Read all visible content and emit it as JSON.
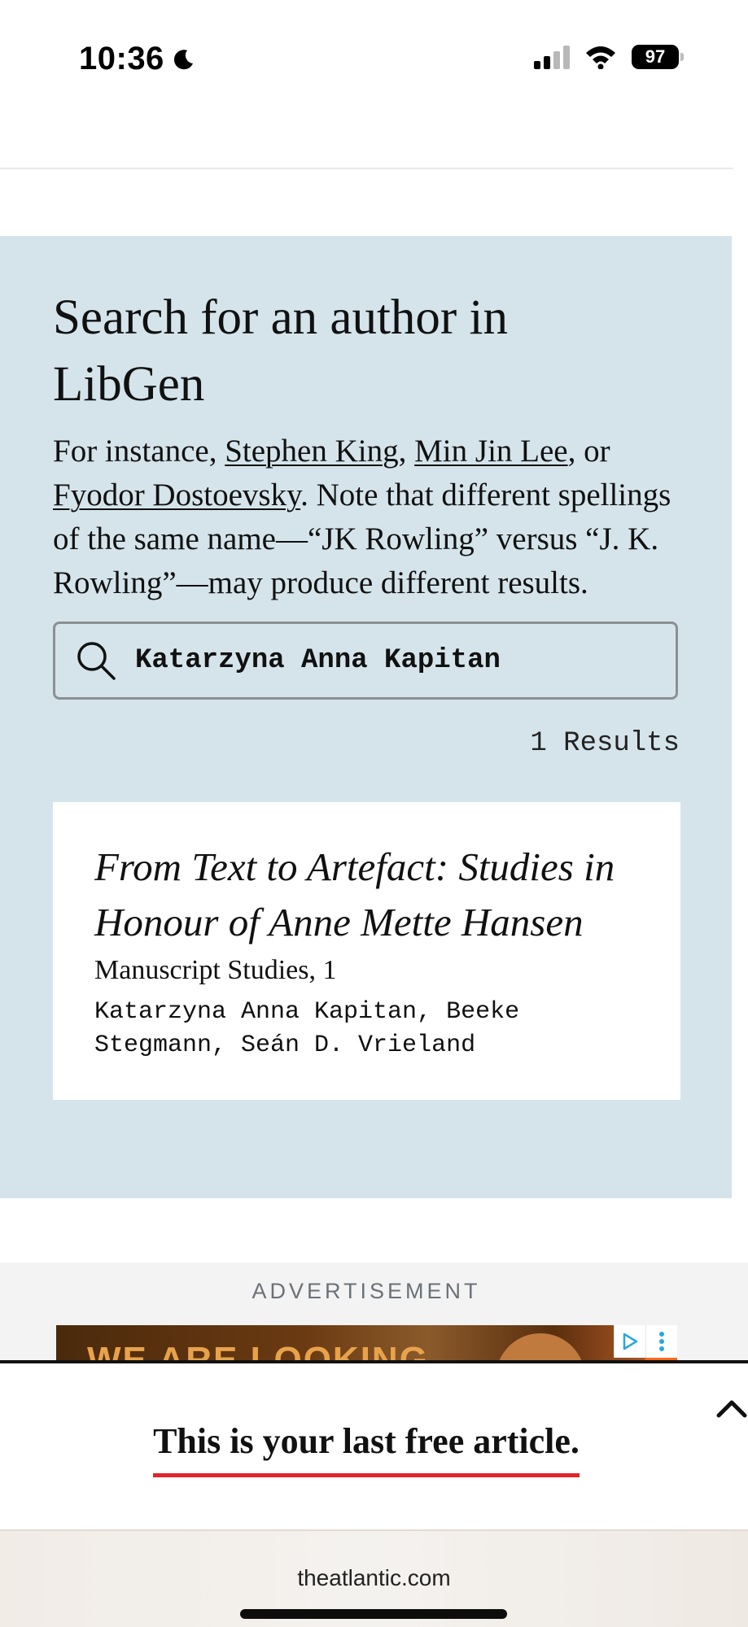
{
  "status_bar": {
    "time": "10:36",
    "battery": "97",
    "icons": [
      "moon-icon",
      "signal-icon",
      "wifi-icon",
      "battery-icon"
    ]
  },
  "search_panel": {
    "title": "Search for an author in LibGen",
    "description": {
      "prefix": "For instance, ",
      "link1": "Stephen King",
      "sep1": ", ",
      "link2": "Min Jin Lee",
      "sep2": ", or ",
      "link3": "Fyodor Dostoevsky",
      "suffix": ". Note that different spellings of the same name—“JK Rowling” versus “J. K. Rowling”—may produce different results."
    },
    "search_value": "Katarzyna Anna Kapitan",
    "search_icon": "search-icon",
    "result_count": "1 Results",
    "results": [
      {
        "title": "From Text to Artefact: Studies in Honour of Anne Mette Hansen",
        "series": "Manuscript Studies, 1",
        "authors": "Katarzyna Anna Kapitan, Beeke Stegmann, Seán D. Vrieland"
      }
    ],
    "background_color": "#d5e4eb"
  },
  "advertisement": {
    "label": "ADVERTISEMENT",
    "banner_text": "WE ARE LOOKING"
  },
  "paywall": {
    "message": "This is your last free article.",
    "accent_color": "#e3232a"
  },
  "browser": {
    "url": "theatlantic.com"
  }
}
